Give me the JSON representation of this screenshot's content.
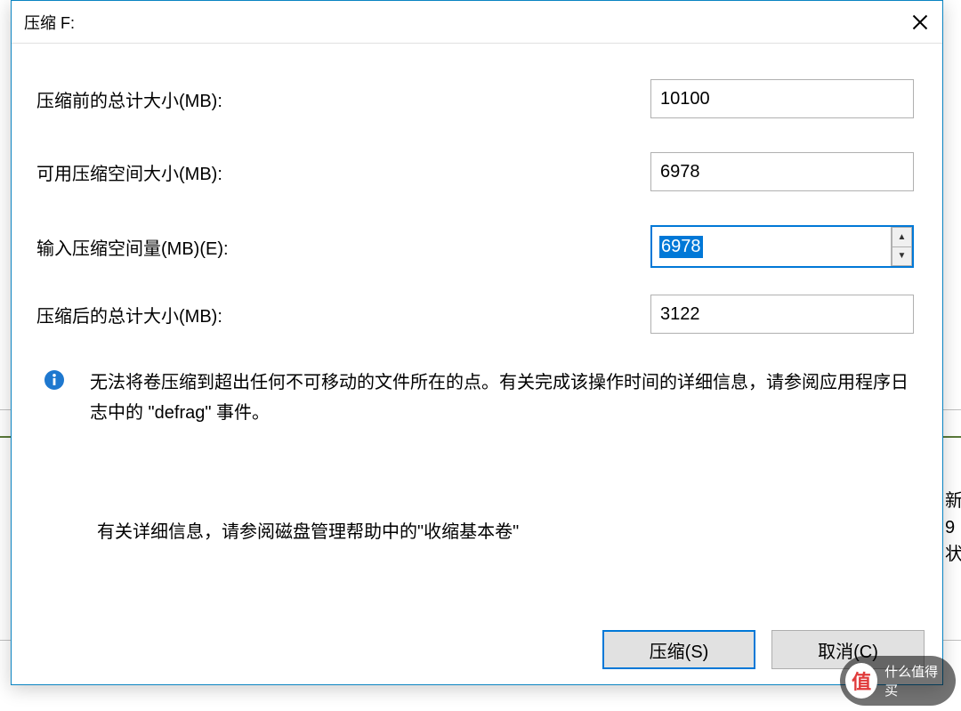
{
  "dialog": {
    "title": "压缩 F:",
    "rows": {
      "before": {
        "label": "压缩前的总计大小(MB):",
        "value": "10100"
      },
      "avail": {
        "label": "可用压缩空间大小(MB):",
        "value": "6978"
      },
      "input": {
        "label": "输入压缩空间量(MB)(E):",
        "value": "6978"
      },
      "after": {
        "label": "压缩后的总计大小(MB):",
        "value": "3122"
      }
    },
    "info_text": "无法将卷压缩到超出任何不可移动的文件所在的点。有关完成该操作时间的详细信息，请参阅应用程序日志中的 \"defrag\" 事件。",
    "help_text": "有关详细信息，请参阅磁盘管理帮助中的\"收缩基本卷\"",
    "buttons": {
      "shrink": "压缩(S)",
      "cancel": "取消(C)"
    }
  },
  "background": {
    "side_line1": "新",
    "side_line2": "9",
    "side_line3": "状"
  },
  "badge": {
    "glyph": "值",
    "text": "什么值得买"
  }
}
